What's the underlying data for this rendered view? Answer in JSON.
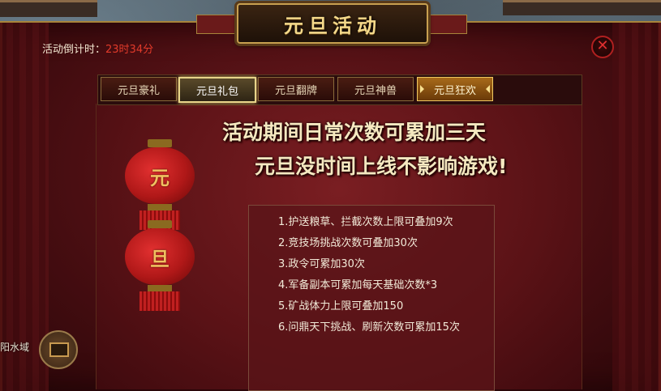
{
  "title": "元旦活动",
  "countdown": {
    "label": "活动倒计时：",
    "value": "23时34分"
  },
  "close_icon": "close-icon",
  "tabs": [
    {
      "label": "元旦豪礼",
      "state": "normal"
    },
    {
      "label": "元旦礼包",
      "state": "selected"
    },
    {
      "label": "元旦翻牌",
      "state": "normal"
    },
    {
      "label": "元旦神兽",
      "state": "normal"
    },
    {
      "label": "元旦狂欢",
      "state": "active"
    }
  ],
  "headline": {
    "line1": "活动期间日常次数可累加三天",
    "line2": "元旦没时间上线不影响游戏!"
  },
  "lanterns": [
    "元",
    "旦"
  ],
  "rules": [
    "1.护送粮草、拦截次数上限可叠加9次",
    "2.竞技场挑战次数可叠加30次",
    "3.政令可累加30次",
    "4.军备副本可累加每天基础次数*3",
    "5.矿战体力上限可叠加150",
    "6.问鼎天下挑战、刷新次数可累加15次"
  ],
  "side": {
    "label": "阳水域",
    "icon": "treasure-chest-icon"
  },
  "colors": {
    "panel": "#4a0e12",
    "gold": "#f4d98a",
    "countdown_value": "#e23a2a"
  }
}
